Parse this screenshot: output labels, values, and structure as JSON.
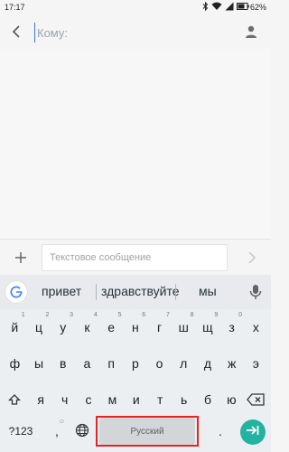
{
  "status_bar": {
    "time": "17:17",
    "battery_percent": "62%",
    "icons": [
      "bluetooth-icon",
      "wifi-icon",
      "signal-icon",
      "battery-icon"
    ]
  },
  "header": {
    "to_placeholder": "Кому:",
    "icons": [
      "back-arrow-icon",
      "contact-icon"
    ]
  },
  "compose": {
    "message_placeholder": "Текстовое сообщение",
    "icons": [
      "plus-icon",
      "send-icon"
    ]
  },
  "keyboard": {
    "suggestions": [
      "привет",
      "здравствуйте",
      "мы"
    ],
    "row1": [
      {
        "k": "й",
        "s": "1"
      },
      {
        "k": "ц",
        "s": "2"
      },
      {
        "k": "у",
        "s": "3"
      },
      {
        "k": "к",
        "s": "4"
      },
      {
        "k": "е",
        "s": "5"
      },
      {
        "k": "н",
        "s": "6"
      },
      {
        "k": "г",
        "s": "7"
      },
      {
        "k": "ш",
        "s": "8"
      },
      {
        "k": "щ",
        "s": "9"
      },
      {
        "k": "з",
        "s": "0"
      },
      {
        "k": "х",
        "s": ""
      }
    ],
    "row2": [
      "ф",
      "ы",
      "в",
      "а",
      "п",
      "р",
      "о",
      "л",
      "д",
      "ж",
      "э"
    ],
    "row3": [
      "я",
      "ч",
      "с",
      "м",
      "и",
      "т",
      "ь",
      "б",
      "ю"
    ],
    "symbols_key": "?123",
    "comma_key": ",",
    "period_key": ".",
    "spacebar_label": "Русский",
    "accent_color": "#22b3a1",
    "highlight_color": "#e32424"
  }
}
